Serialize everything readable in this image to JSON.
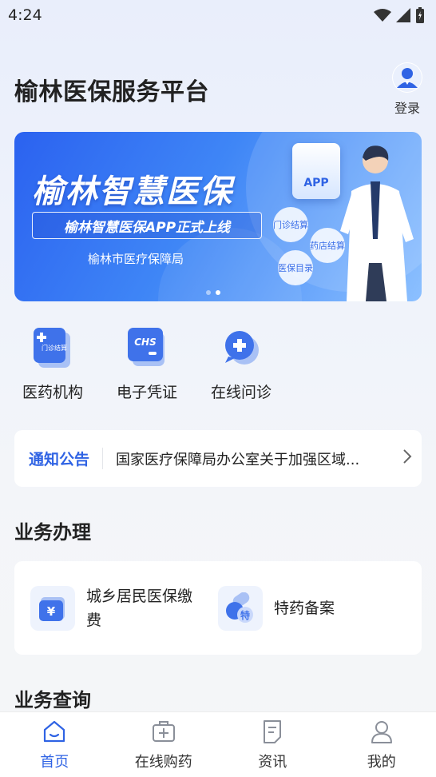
{
  "status_bar": {
    "time": "4:24"
  },
  "header": {
    "title": "榆林医保服务平台",
    "login_label": "登录"
  },
  "banner": {
    "title": "榆林智慧医保",
    "subtitle": "榆林智慧医保APP正式上线",
    "org": "榆林市医疗保障局",
    "card_label": "APP",
    "bubbles": [
      "门诊结算",
      "药店结算",
      "医保目录"
    ],
    "page_count": 2,
    "active_page": 2
  },
  "quick_actions": [
    {
      "label": "医药机构",
      "icon": "clinic-settlement-icon",
      "icon_text": "门诊结算"
    },
    {
      "label": "电子凭证",
      "icon": "chs-card-icon",
      "icon_text": "CHS"
    },
    {
      "label": "在线问诊",
      "icon": "chat-plus-icon"
    }
  ],
  "notice": {
    "tag": "通知公告",
    "text": "国家医疗保障局办公室关于加强区域..."
  },
  "business": {
    "title": "业务办理",
    "items": [
      {
        "label": "城乡居民医保缴费",
        "icon": "yuan-payment-icon"
      },
      {
        "label": "特药备案",
        "icon": "special-drug-icon",
        "icon_text": "特"
      }
    ]
  },
  "query": {
    "title": "业务查询"
  },
  "tabbar": {
    "items": [
      {
        "label": "首页",
        "icon": "home-icon",
        "active": true
      },
      {
        "label": "在线购药",
        "icon": "medicine-kit-icon"
      },
      {
        "label": "资讯",
        "icon": "news-icon"
      },
      {
        "label": "我的",
        "icon": "profile-icon"
      }
    ]
  },
  "colors": {
    "primary": "#2f63e4",
    "background": "#eef2fb",
    "banner_start": "#2b62f0",
    "banner_end": "#8cc0ff"
  }
}
